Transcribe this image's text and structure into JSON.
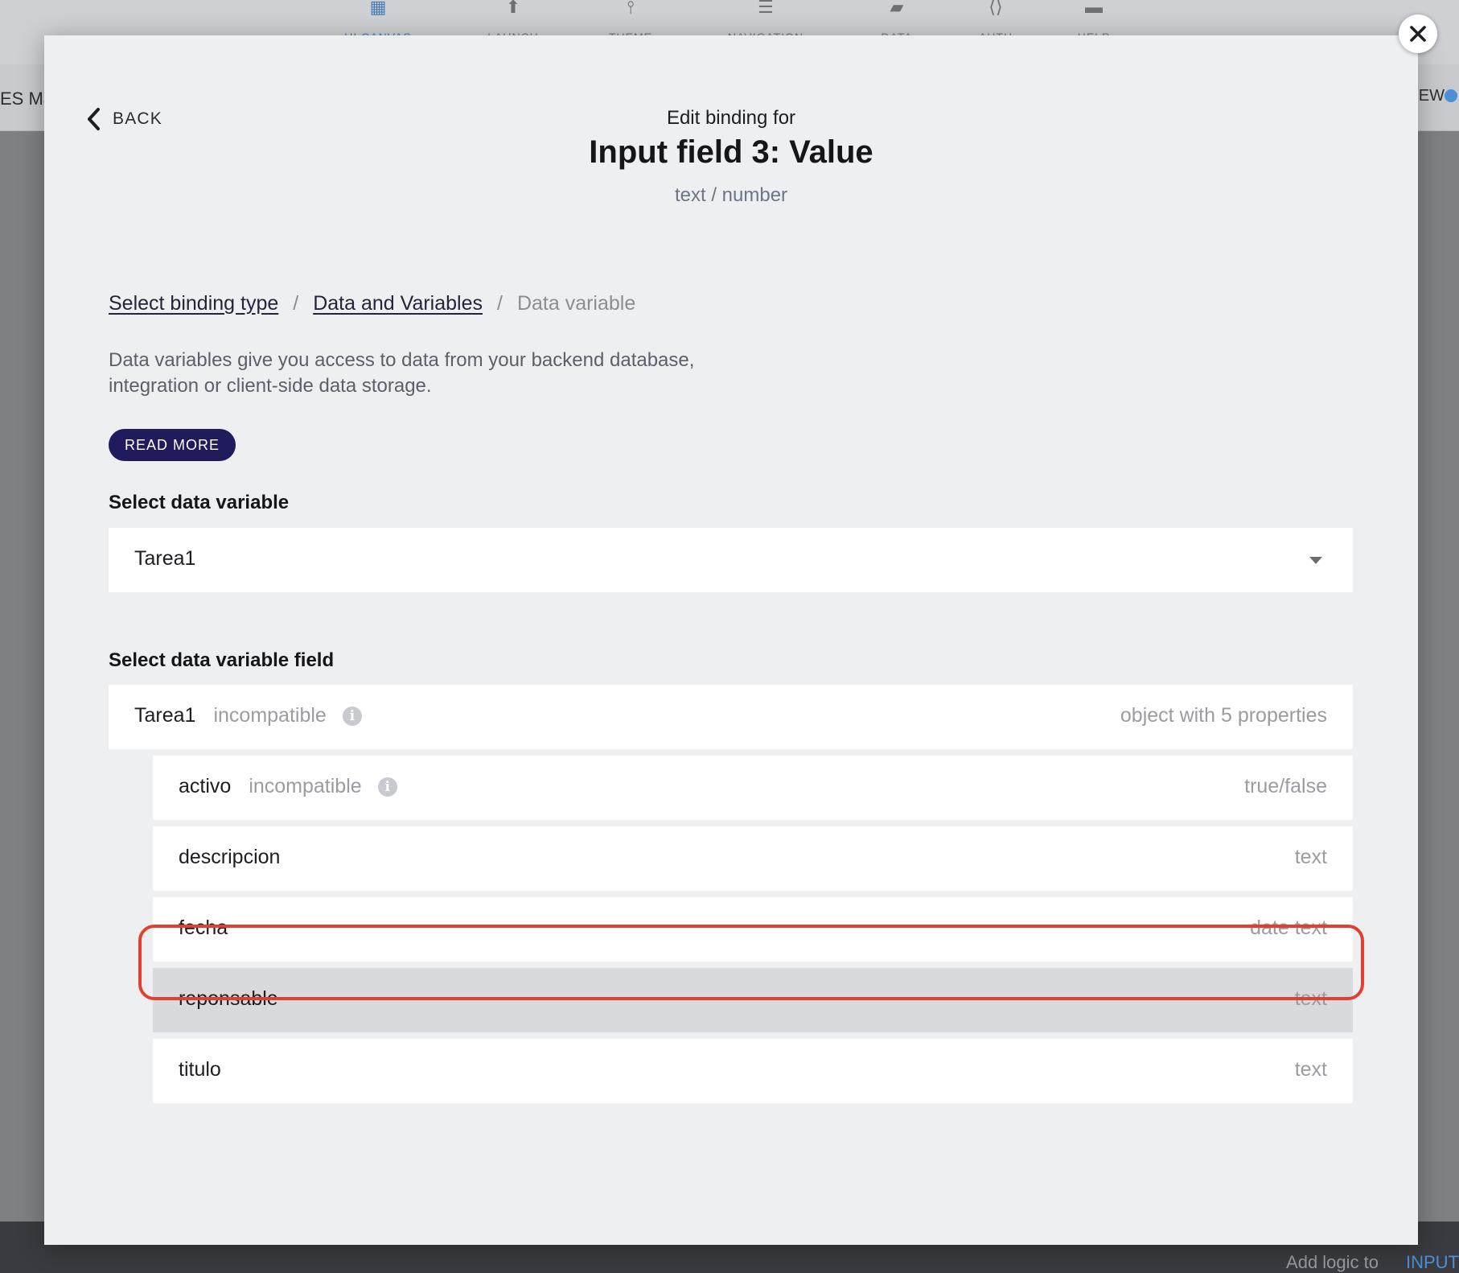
{
  "background": {
    "left_title": "ES Ma",
    "right_title": "EW",
    "footer_text": "Add logic to",
    "footer_accent": "INPUT"
  },
  "modal": {
    "back_label": "BACK",
    "kicker": "Edit binding for",
    "title": "Input field 3: Value",
    "type_hint": "text / number"
  },
  "breadcrumb": {
    "items": [
      {
        "label": "Select binding type"
      },
      {
        "label": "Data and Variables"
      },
      {
        "label": "Data variable"
      }
    ],
    "separator": "/"
  },
  "description": "Data variables give you access to data from your backend database, integration or client-side data storage.",
  "read_more_label": "READ MORE",
  "select_variable": {
    "label": "Select data variable",
    "value": "Tarea1"
  },
  "select_field": {
    "label": "Select data variable field",
    "root": {
      "name": "Tarea1",
      "badge": "incompatible",
      "type": "object with 5 properties"
    },
    "children": [
      {
        "name": "activo",
        "badge": "incompatible",
        "type": "true/false"
      },
      {
        "name": "descripcion",
        "badge": "",
        "type": "text"
      },
      {
        "name": "fecha",
        "badge": "",
        "type": "date text"
      },
      {
        "name": "reponsable",
        "badge": "",
        "type": "text",
        "highlighted": true
      },
      {
        "name": "titulo",
        "badge": "",
        "type": "text"
      }
    ]
  },
  "colors": {
    "accent_button": "#1f1b5c",
    "highlight_ring": "#e2402e",
    "link_blue": "#4a90d9"
  },
  "icons": {
    "close": "close-icon",
    "back": "chevron-left-icon",
    "dropdown": "caret-down-icon",
    "info": "info-icon"
  }
}
